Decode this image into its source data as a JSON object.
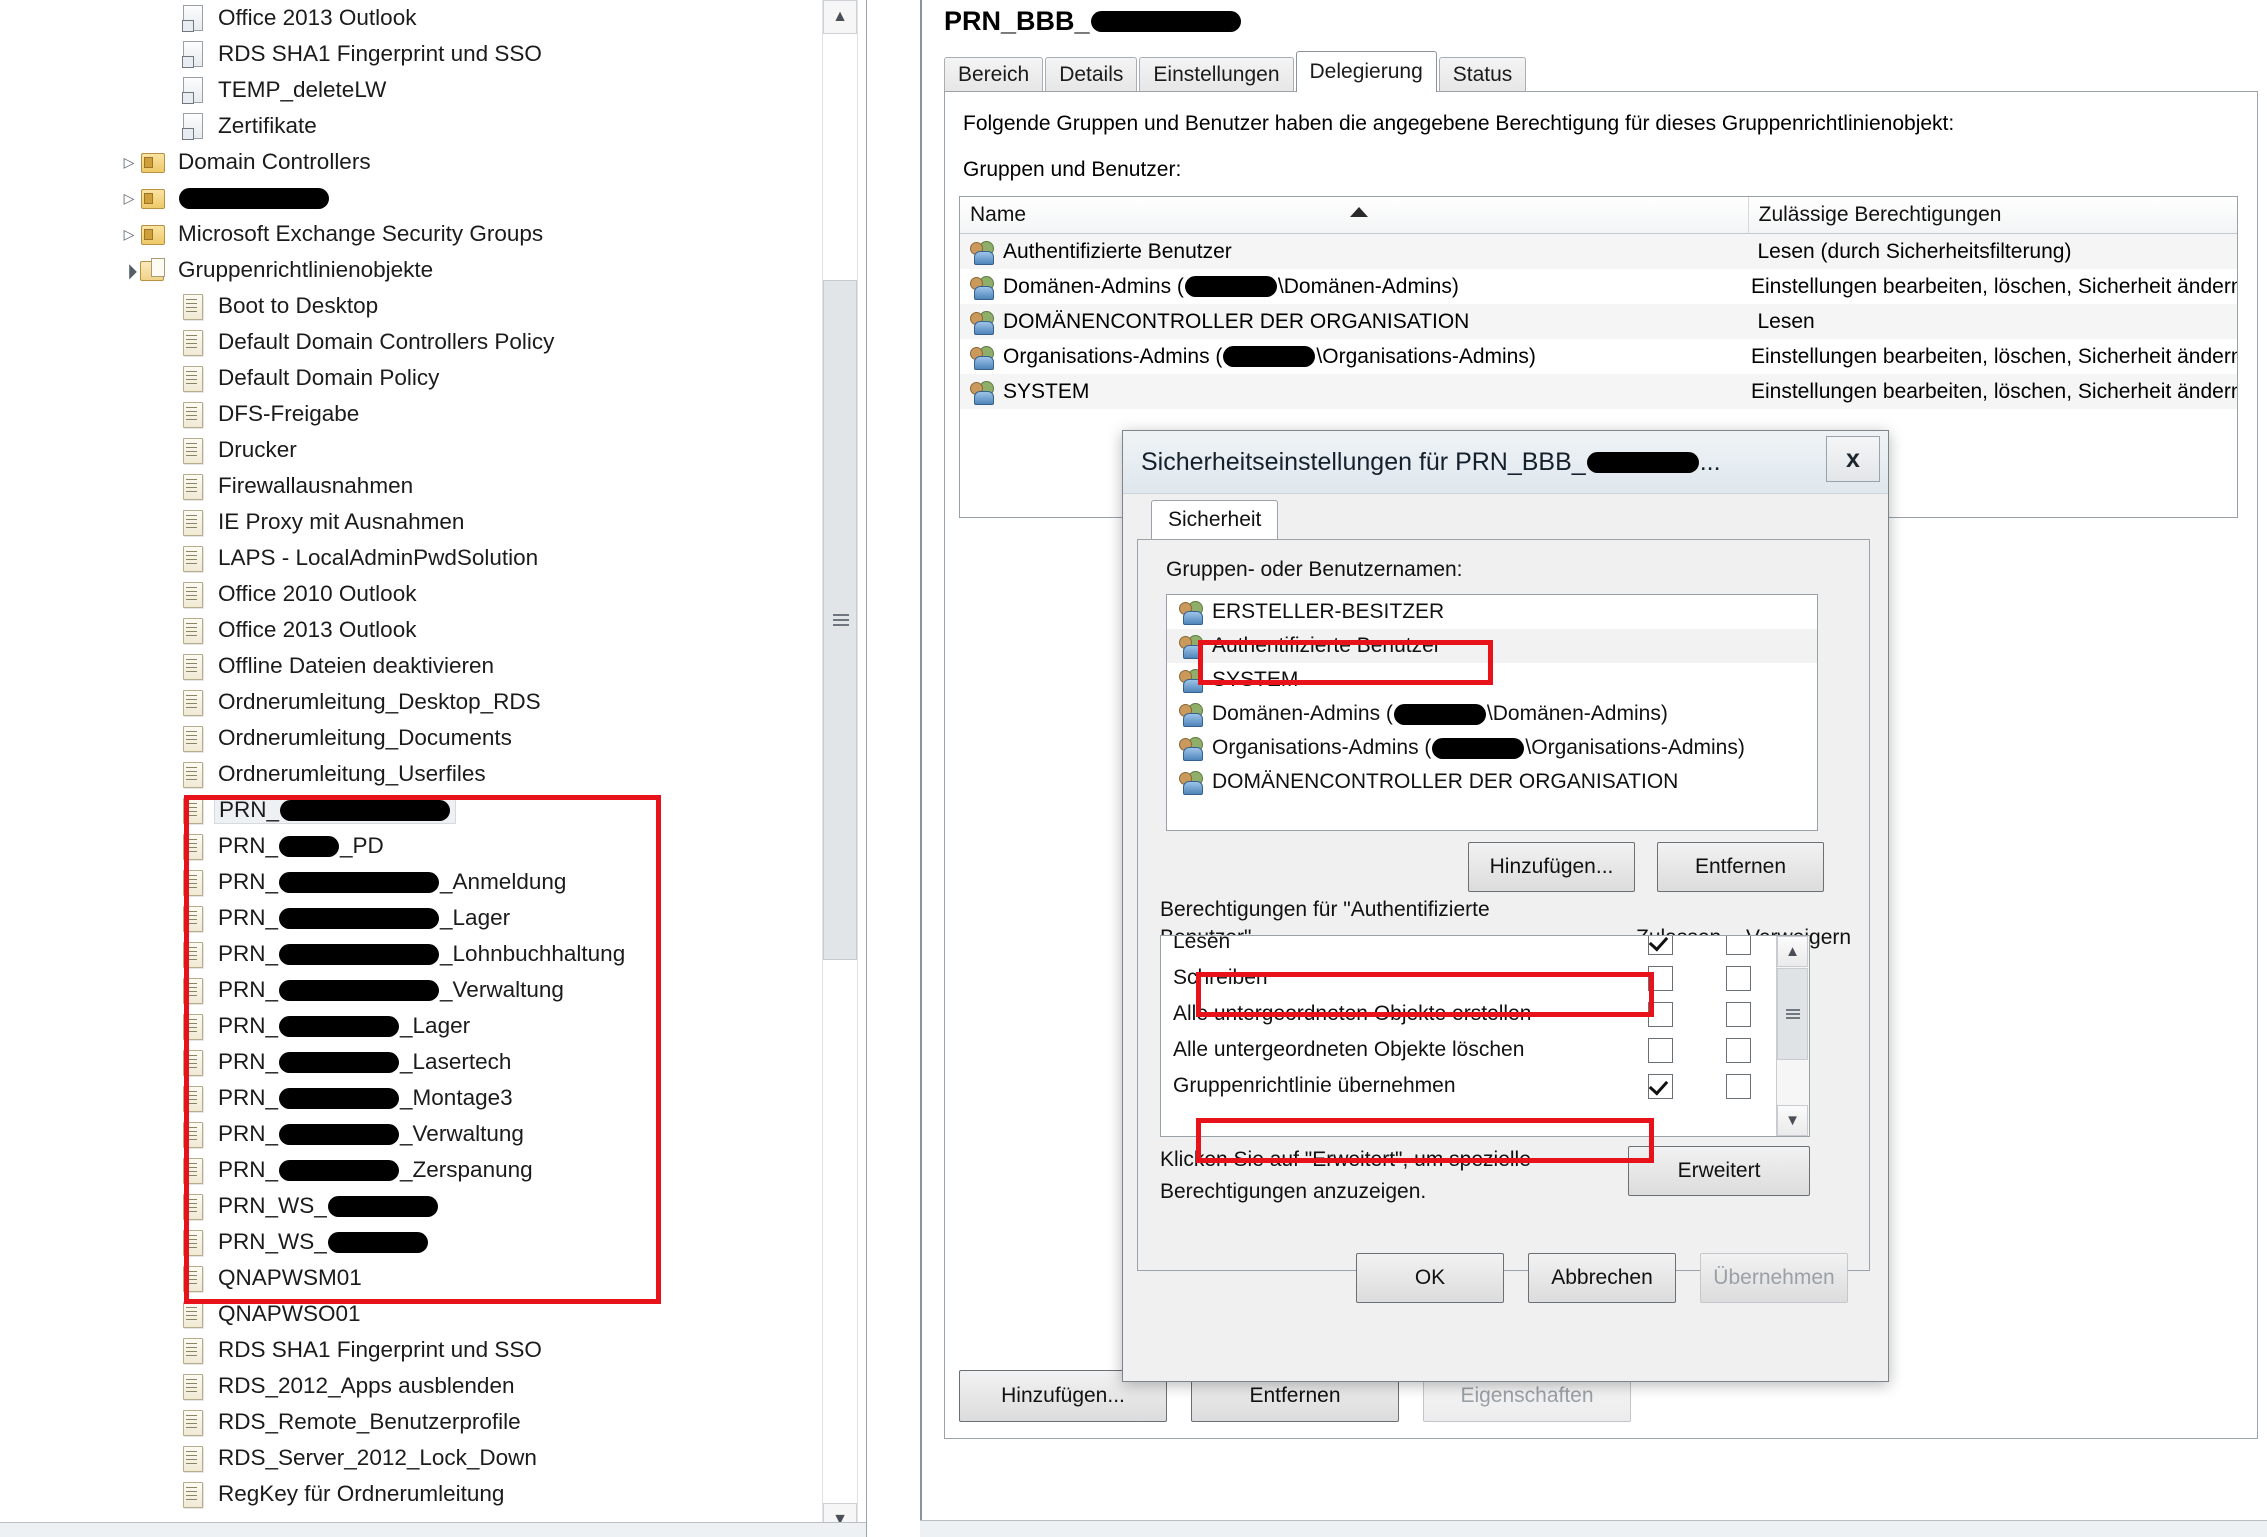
{
  "tree": {
    "items": [
      {
        "label": "Office 2013 Outlook",
        "icon": "link-gpo-icon",
        "indent": 2,
        "twisty": "none",
        "selected": false
      },
      {
        "label": "RDS SHA1 Fingerprint und SSO",
        "icon": "link-gpo-icon",
        "indent": 2,
        "twisty": "none",
        "selected": false
      },
      {
        "label": "TEMP_deleteLW",
        "icon": "link-gpo-icon",
        "indent": 2,
        "twisty": "none",
        "selected": false
      },
      {
        "label": "Zertifikate",
        "icon": "link-gpo-icon",
        "indent": 2,
        "twisty": "none",
        "selected": false
      },
      {
        "label": "Domain Controllers",
        "icon": "ou-folder-icon",
        "indent": 1,
        "twisty": "collapsed",
        "selected": false
      },
      {
        "label": "",
        "redacted": 150,
        "icon": "ou-folder-icon",
        "indent": 1,
        "twisty": "collapsed",
        "selected": false
      },
      {
        "label": "Microsoft Exchange Security Groups",
        "icon": "ou-folder-icon",
        "indent": 1,
        "twisty": "collapsed",
        "selected": false
      },
      {
        "label": "Gruppenrichtlinienobjekte",
        "icon": "gpo-container-icon",
        "indent": 1,
        "twisty": "expanded",
        "selected": false
      },
      {
        "label": "Boot to Desktop",
        "icon": "gpo-icon",
        "indent": 2,
        "twisty": "none",
        "selected": false
      },
      {
        "label": "Default Domain Controllers Policy",
        "icon": "gpo-icon",
        "indent": 2,
        "twisty": "none",
        "selected": false
      },
      {
        "label": "Default Domain Policy",
        "icon": "gpo-icon",
        "indent": 2,
        "twisty": "none",
        "selected": false
      },
      {
        "label": "DFS-Freigabe",
        "icon": "gpo-icon",
        "indent": 2,
        "twisty": "none",
        "selected": false
      },
      {
        "label": "Drucker",
        "icon": "gpo-icon",
        "indent": 2,
        "twisty": "none",
        "selected": false
      },
      {
        "label": "Firewallausnahmen",
        "icon": "gpo-icon",
        "indent": 2,
        "twisty": "none",
        "selected": false
      },
      {
        "label": "IE Proxy mit Ausnahmen",
        "icon": "gpo-icon",
        "indent": 2,
        "twisty": "none",
        "selected": false
      },
      {
        "label": "LAPS - LocalAdminPwdSolution",
        "icon": "gpo-icon",
        "indent": 2,
        "twisty": "none",
        "selected": false
      },
      {
        "label": "Office 2010 Outlook",
        "icon": "gpo-icon",
        "indent": 2,
        "twisty": "none",
        "selected": false
      },
      {
        "label": "Office 2013 Outlook",
        "icon": "gpo-icon",
        "indent": 2,
        "twisty": "none",
        "selected": false
      },
      {
        "label": "Offline Dateien deaktivieren",
        "icon": "gpo-icon",
        "indent": 2,
        "twisty": "none",
        "selected": false
      },
      {
        "label": "Ordnerumleitung_Desktop_RDS",
        "icon": "gpo-icon",
        "indent": 2,
        "twisty": "none",
        "selected": false
      },
      {
        "label": "Ordnerumleitung_Documents",
        "icon": "gpo-icon",
        "indent": 2,
        "twisty": "none",
        "selected": false
      },
      {
        "label": "Ordnerumleitung_Userfiles",
        "icon": "gpo-icon",
        "indent": 2,
        "twisty": "none",
        "selected": false
      },
      {
        "label": "PRN_",
        "redacted": 170,
        "suffix": "",
        "icon": "gpo-icon",
        "indent": 2,
        "twisty": "none",
        "selected": true
      },
      {
        "label": "PRN_",
        "redacted": 60,
        "suffix": "_PD",
        "icon": "gpo-icon",
        "indent": 2,
        "twisty": "none",
        "selected": false
      },
      {
        "label": "PRN_",
        "redacted": 160,
        "suffix": "_Anmeldung",
        "icon": "gpo-icon",
        "indent": 2,
        "twisty": "none",
        "selected": false
      },
      {
        "label": "PRN_",
        "redacted": 160,
        "suffix": "_Lager",
        "icon": "gpo-icon",
        "indent": 2,
        "twisty": "none",
        "selected": false
      },
      {
        "label": "PRN_",
        "redacted": 160,
        "suffix": "_Lohnbuchhaltung",
        "icon": "gpo-icon",
        "indent": 2,
        "twisty": "none",
        "selected": false
      },
      {
        "label": "PRN_",
        "redacted": 160,
        "suffix": "_Verwaltung",
        "icon": "gpo-icon",
        "indent": 2,
        "twisty": "none",
        "selected": false
      },
      {
        "label": "PRN_",
        "redacted": 120,
        "suffix": "_Lager",
        "icon": "gpo-icon",
        "indent": 2,
        "twisty": "none",
        "selected": false
      },
      {
        "label": "PRN_",
        "redacted": 120,
        "suffix": "_Lasertech",
        "icon": "gpo-icon",
        "indent": 2,
        "twisty": "none",
        "selected": false
      },
      {
        "label": "PRN_",
        "redacted": 120,
        "suffix": "_Montage3",
        "icon": "gpo-icon",
        "indent": 2,
        "twisty": "none",
        "selected": false
      },
      {
        "label": "PRN_",
        "redacted": 120,
        "suffix": "_Verwaltung",
        "icon": "gpo-icon",
        "indent": 2,
        "twisty": "none",
        "selected": false
      },
      {
        "label": "PRN_",
        "redacted": 120,
        "suffix": "_Zerspanung",
        "icon": "gpo-icon",
        "indent": 2,
        "twisty": "none",
        "selected": false
      },
      {
        "label": "PRN_WS_",
        "redacted": 110,
        "suffix": "",
        "icon": "gpo-icon",
        "indent": 2,
        "twisty": "none",
        "selected": false
      },
      {
        "label": "PRN_WS_",
        "redacted": 100,
        "suffix": "",
        "icon": "gpo-icon",
        "indent": 2,
        "twisty": "none",
        "selected": false
      },
      {
        "label": "QNAPWSM01",
        "icon": "gpo-icon",
        "indent": 2,
        "twisty": "none",
        "selected": false
      },
      {
        "label": "QNAPWSO01",
        "icon": "gpo-icon",
        "indent": 2,
        "twisty": "none",
        "selected": false
      },
      {
        "label": "RDS SHA1 Fingerprint und SSO",
        "icon": "gpo-icon",
        "indent": 2,
        "twisty": "none",
        "selected": false
      },
      {
        "label": "RDS_2012_Apps ausblenden",
        "icon": "gpo-icon",
        "indent": 2,
        "twisty": "none",
        "selected": false
      },
      {
        "label": "RDS_Remote_Benutzerprofile",
        "icon": "gpo-icon",
        "indent": 2,
        "twisty": "none",
        "selected": false
      },
      {
        "label": "RDS_Server_2012_Lock_Down",
        "icon": "gpo-icon",
        "indent": 2,
        "twisty": "none",
        "selected": false
      },
      {
        "label": "RegKey für Ordnerumleitung",
        "icon": "gpo-icon",
        "indent": 2,
        "twisty": "none",
        "selected": false
      }
    ]
  },
  "result": {
    "title": "PRN_BBB_",
    "tabs": [
      {
        "label": "Bereich",
        "active": false
      },
      {
        "label": "Details",
        "active": false
      },
      {
        "label": "Einstellungen",
        "active": false
      },
      {
        "label": "Delegierung",
        "active": true
      },
      {
        "label": "Status",
        "active": false
      }
    ],
    "description": "Folgende Gruppen und Benutzer haben die angegebene Berechtigung für dieses Gruppenrichtlinienobjekt:",
    "sublabel": "Gruppen und Benutzer:",
    "columns": [
      "Name",
      "Zulässige Berechtigungen"
    ],
    "rows": [
      {
        "name": "Authentifizierte Benutzer",
        "perm": "Lesen (durch Sicherheitsfilterung)"
      },
      {
        "name": "Domänen-Admins (",
        "name_suffix": "\\Domänen-Admins)",
        "redacted": 92,
        "perm": "Einstellungen bearbeiten, löschen, Sicherheit ändern"
      },
      {
        "name": "DOMÄNENCONTROLLER DER ORGANISATION",
        "perm": "Lesen"
      },
      {
        "name": "Organisations-Admins (",
        "name_suffix": "\\Organisations-Admins)",
        "redacted": 92,
        "perm": "Einstellungen bearbeiten, löschen, Sicherheit ändern"
      },
      {
        "name": "SYSTEM",
        "perm": "Einstellungen bearbeiten, löschen, Sicherheit ändern"
      }
    ],
    "buttons": [
      {
        "label": "Hinzufügen...",
        "disabled": false
      },
      {
        "label": "Entfernen",
        "disabled": false
      },
      {
        "label": "Eigenschaften",
        "disabled": true
      }
    ]
  },
  "dialog": {
    "title": "Sicherheitseinstellungen für PRN_BBB_",
    "title_ellipsis": "...",
    "close_label": "x",
    "tab_label": "Sicherheit",
    "users_label": "Gruppen- oder Benutzernamen:",
    "users": [
      {
        "name": "ERSTELLER-BESITZER",
        "highlighted": false,
        "selected": false
      },
      {
        "name": "Authentifizierte Benutzer",
        "highlighted": true,
        "selected": true
      },
      {
        "name": "SYSTEM",
        "highlighted": false,
        "selected": false
      },
      {
        "name": "Domänen-Admins (",
        "suffix": "\\Domänen-Admins)",
        "redacted": 92,
        "highlighted": false,
        "selected": false
      },
      {
        "name": "Organisations-Admins (",
        "suffix": "\\Organisations-Admins)",
        "redacted": 92,
        "highlighted": false,
        "selected": false
      },
      {
        "name": "DOMÄNENCONTROLLER DER ORGANISATION",
        "highlighted": false,
        "selected": false
      }
    ],
    "list_buttons": [
      {
        "label": "Hinzufügen...",
        "disabled": false
      },
      {
        "label": "Entfernen",
        "disabled": false
      }
    ],
    "perm_label_line1": "Berechtigungen für \"Authentifizierte",
    "perm_label_line2": "Benutzer\"",
    "perm_col_allow": "Zulassen",
    "perm_col_deny": "Verweigern",
    "permissions": [
      {
        "label": "Lesen",
        "allow": true,
        "deny": false,
        "highlighted": true
      },
      {
        "label": "Schreiben",
        "allow": false,
        "deny": false,
        "highlighted": false
      },
      {
        "label": "Alle untergeordneten Objekte erstellen",
        "allow": false,
        "deny": false,
        "highlighted": false
      },
      {
        "label": "Alle untergeordneten Objekte löschen",
        "allow": false,
        "deny": false,
        "highlighted": false
      },
      {
        "label": "Gruppenrichtlinie übernehmen",
        "allow": true,
        "deny": false,
        "highlighted": true
      }
    ],
    "advanced_hint_line1": "Klicken Sie auf \"Erweitert\", um spezielle",
    "advanced_hint_line2": "Berechtigungen anzuzeigen.",
    "advanced_button": "Erweitert",
    "footer_buttons": [
      {
        "label": "OK",
        "disabled": false
      },
      {
        "label": "Abbrechen",
        "disabled": false
      },
      {
        "label": "Übernehmen",
        "disabled": true
      }
    ]
  },
  "colors": {
    "highlight_red": "#e8121a",
    "redaction_black": "#000000",
    "selection_grey": "#f2f2f2"
  }
}
